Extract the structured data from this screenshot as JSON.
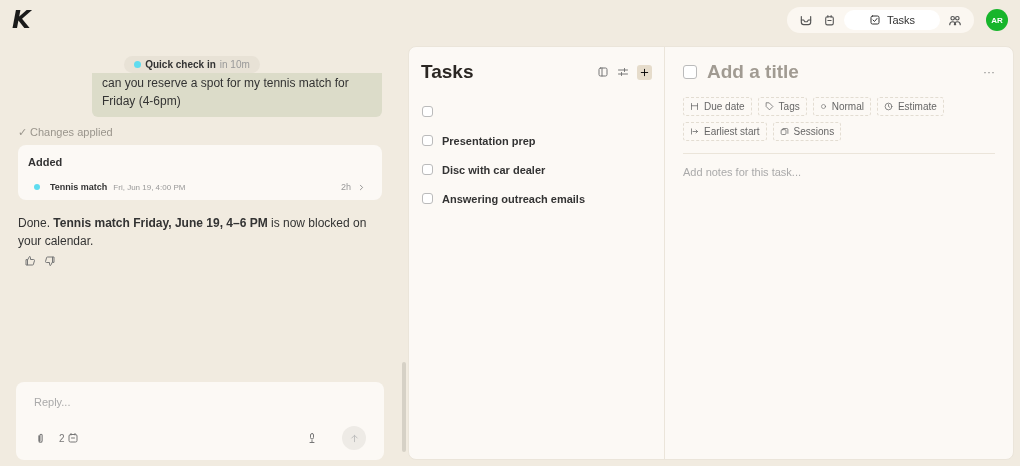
{
  "logo": "K",
  "nav": {
    "tabs": [
      {
        "label": "Tasks",
        "selected": true
      }
    ],
    "avatar": "AR"
  },
  "chat": {
    "reminder": {
      "title": "Quick check in",
      "time": "in 10m",
      "color": "#5fdcef"
    },
    "user_message": "can you reserve a spot for my tennis match for Friday (4-6pm)",
    "status": "✓ Changes applied",
    "card": {
      "title": "Added",
      "events": [
        {
          "title": "Tennis match",
          "when": "Fri, Jun 19, 4:00 PM",
          "duration": "2h",
          "color": "#5fdcef"
        }
      ]
    },
    "reply": "Done. **Tennis match Friday, June 19, 4–6 PM** is now blocked on your calendar.",
    "composer": {
      "placeholder": "Reply...",
      "calendar_count": "2",
      "send_disabled": true
    }
  },
  "tasks": {
    "title": "Tasks",
    "items": [
      {
        "checked": false
      },
      {
        "title": "Presentation prep",
        "checked": false
      },
      {
        "title": "Disc with car dealer",
        "checked": false
      },
      {
        "title": "Answering outreach emails",
        "checked": false
      }
    ]
  },
  "detail": {
    "checked": false,
    "title_placeholder": "Add a title",
    "more": "···",
    "properties": [
      {
        "kind": "due",
        "label": "Due date"
      },
      {
        "kind": "tags",
        "label": "Tags"
      },
      {
        "kind": "priority",
        "label": "Normal"
      },
      {
        "kind": "estimate",
        "label": "Estimate"
      },
      {
        "kind": "start",
        "label": "Earliest start"
      },
      {
        "kind": "sessions",
        "label": "Sessions"
      }
    ],
    "notes_placeholder": "Add notes for this task..."
  }
}
